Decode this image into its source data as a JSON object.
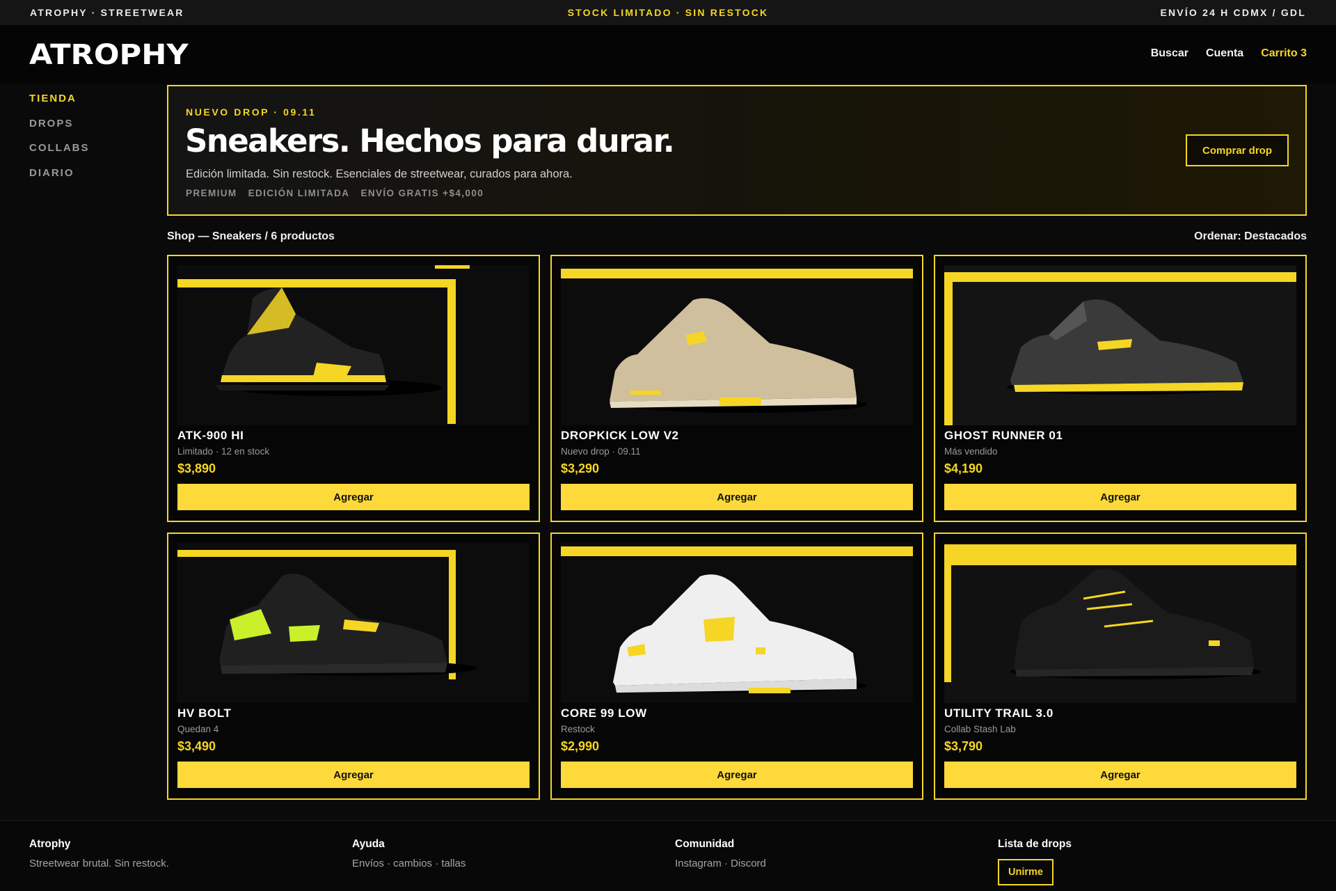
{
  "topbar": {
    "left": "ATROPHY · STREETWEAR",
    "center": "STOCK LIMITADO · SIN RESTOCK",
    "right": "ENVÍO 24 H CDMX / GDL"
  },
  "header": {
    "logo": "ATROPHY",
    "nav": {
      "search": "Buscar",
      "account": "Cuenta",
      "cart": "Carrito 3"
    }
  },
  "sidebar": {
    "items": [
      {
        "label": "TIENDA",
        "active": true
      },
      {
        "label": "DROPS"
      },
      {
        "label": "COLLABS"
      },
      {
        "label": "DIARIO"
      }
    ]
  },
  "hero": {
    "kicker": "NUEVO DROP · 09.11",
    "title": "Sneakers. Hechos para durar.",
    "subtitle": "Edición limitada. Sin restock. Esenciales de streetwear, curados para ahora.",
    "tags": [
      "PREMIUM",
      "EDICIÓN LIMITADA",
      "ENVÍO GRATIS +$4,000"
    ],
    "cta": "Comprar drop"
  },
  "shop": {
    "breadcrumb": "Shop — Sneakers / 6 productos",
    "sort": "Ordenar: Destacados"
  },
  "colors": {
    "accent": "#f5d624",
    "button": "#fdd93a",
    "background": "#0a0a0a"
  },
  "products": [
    {
      "name": "ATK-900 HI",
      "meta": "Limitado · 12 en stock",
      "price": "$3,890",
      "add": "Agregar",
      "image": "sneaker-black-yellow-hi"
    },
    {
      "name": "DROPKICK LOW V2",
      "meta": "Nuevo drop · 09.11",
      "price": "$3,290",
      "add": "Agregar",
      "image": "sneaker-beige-low"
    },
    {
      "name": "GHOST RUNNER 01",
      "meta": "Más vendido",
      "price": "$4,190",
      "add": "Agregar",
      "image": "sneaker-grey-runner"
    },
    {
      "name": "HV BOLT",
      "meta": "Quedan 4",
      "price": "$3,490",
      "add": "Agregar",
      "image": "sneaker-black-neon"
    },
    {
      "name": "CORE 99 LOW",
      "meta": "Restock",
      "price": "$2,990",
      "add": "Agregar",
      "image": "sneaker-white-yellow-low"
    },
    {
      "name": "UTILITY TRAIL 3.0",
      "meta": "Collab Stash Lab",
      "price": "$3,790",
      "add": "Agregar",
      "image": "sneaker-black-trail"
    }
  ],
  "footer": {
    "brand": {
      "heading": "Atrophy",
      "text": "Streetwear brutal. Sin restock."
    },
    "help": {
      "heading": "Ayuda",
      "text": "Envíos · cambios · tallas"
    },
    "community": {
      "heading": "Comunidad",
      "text": "Instagram · Discord"
    },
    "drops": {
      "heading": "Lista de drops",
      "button": "Unirme"
    }
  }
}
